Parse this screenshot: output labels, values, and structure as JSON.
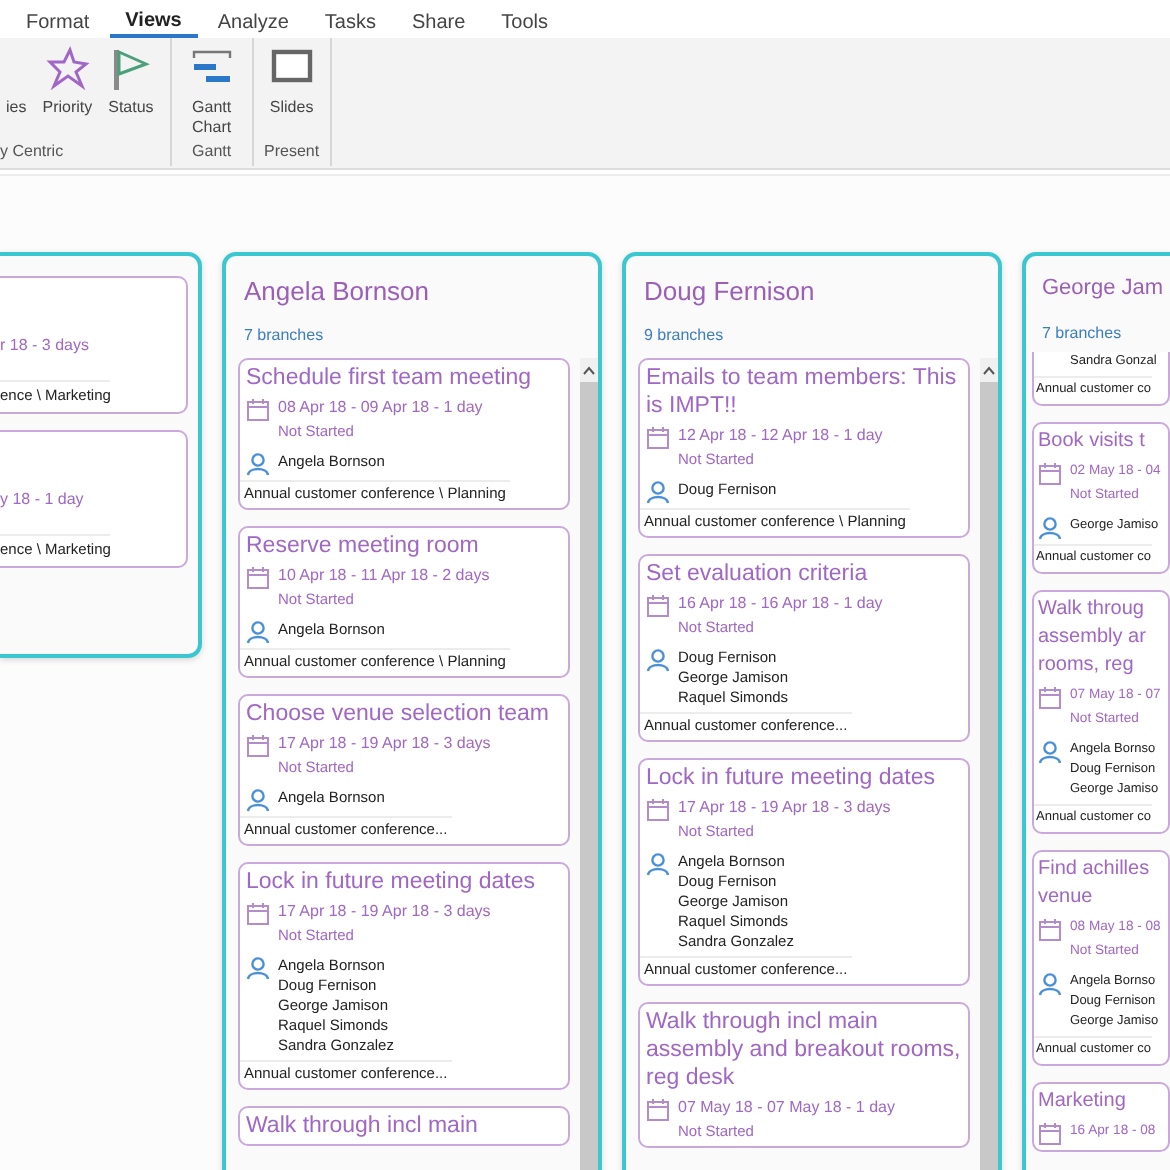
{
  "ribbon": {
    "tabs": [
      {
        "label": "Format",
        "selected": false
      },
      {
        "label": "Views",
        "selected": true
      },
      {
        "label": "Analyze",
        "selected": false
      },
      {
        "label": "Tasks",
        "selected": false
      },
      {
        "label": "Share",
        "selected": false
      },
      {
        "label": "Tools",
        "selected": false
      }
    ],
    "groups": [
      {
        "label": "y Centric",
        "kind": "cut",
        "buttons": [
          {
            "label": "ies"
          },
          {
            "label": "Priority"
          },
          {
            "label": "Status"
          }
        ]
      },
      {
        "label": "Gantt",
        "kind": "normal",
        "buttons": [
          {
            "label": "Gantt Chart"
          }
        ]
      },
      {
        "label": "Present",
        "kind": "normal",
        "buttons": [
          {
            "label": "Slides"
          }
        ]
      }
    ]
  },
  "columns": [
    {
      "kind": "left-cut",
      "cards": [
        {
          "kind": "left-cut",
          "date": "r 18 - 3 days",
          "project": "ence \\ Marketing"
        },
        {
          "kind": "left-cut",
          "date": "y 18 - 1 day",
          "project": "ence \\ Marketing"
        }
      ]
    },
    {
      "kind": "full",
      "name": "Angela Bornson",
      "branches": "7 branches",
      "cards": [
        {
          "kind": "full",
          "title": "Schedule first team meeting",
          "date": "08 Apr 18 - 09 Apr 18 - 1 day",
          "status": "Not Started",
          "people": [
            "Angela Bornson"
          ],
          "project": "Annual customer conference \\ Planning"
        },
        {
          "kind": "full",
          "title": "Reserve meeting room",
          "date": "10 Apr 18 - 11 Apr 18 - 2 days",
          "status": "Not Started",
          "people": [
            "Angela Bornson"
          ],
          "project": "Annual customer conference \\ Planning"
        },
        {
          "kind": "full",
          "title": "Choose venue selection team",
          "date": "17 Apr 18 - 19 Apr 18 - 3 days",
          "status": "Not Started",
          "people": [
            "Angela Bornson"
          ],
          "project": "Annual customer conference..."
        },
        {
          "kind": "full",
          "title": "Lock in future meeting dates",
          "date": "17 Apr 18 - 19 Apr 18 - 3 days",
          "status": "Not Started",
          "people": [
            "Angela Bornson",
            "Doug Fernison",
            "George Jamison",
            "Raquel Simonds",
            "Sandra Gonzalez"
          ],
          "project": "Annual customer conference..."
        },
        {
          "kind": "full",
          "title": "Walk through incl main"
        }
      ]
    },
    {
      "kind": "full",
      "name": "Doug Fernison",
      "branches": "9 branches",
      "cards": [
        {
          "kind": "full",
          "title": "Emails to team members: This is IMPT!!",
          "date": "12 Apr 18 - 12 Apr 18 - 1 day",
          "status": "Not Started",
          "people": [
            "Doug Fernison"
          ],
          "project": "Annual customer conference \\ Planning"
        },
        {
          "kind": "full",
          "title": "Set evaluation criteria",
          "date": "16 Apr 18 - 16 Apr 18 - 1 day",
          "status": "Not Started",
          "people": [
            "Doug Fernison",
            "George Jamison",
            "Raquel Simonds"
          ],
          "project": "Annual customer conference..."
        },
        {
          "kind": "full",
          "title": "Lock in future meeting dates",
          "date": "17 Apr 18 - 19 Apr 18 - 3 days",
          "status": "Not Started",
          "people": [
            "Angela Bornson",
            "Doug Fernison",
            "George Jamison",
            "Raquel Simonds",
            "Sandra Gonzalez"
          ],
          "project": "Annual customer conference..."
        },
        {
          "kind": "full",
          "title": "Walk through incl main assembly and breakout rooms, reg desk",
          "date": "07 May 18 - 07 May 18 - 1 day",
          "status": "Not Started"
        }
      ]
    },
    {
      "kind": "right-cut",
      "name": "George Jam",
      "branches": "7 branches",
      "cards": [
        {
          "kind": "top-cut",
          "people": [
            "Sandra Gonzal"
          ],
          "project": "Annual customer co"
        },
        {
          "kind": "full",
          "title": "Book visits t",
          "date": "02 May 18 - 04",
          "status": "Not Started",
          "people": [
            "George Jamiso"
          ],
          "project": "Annual customer co"
        },
        {
          "kind": "full",
          "title": "Walk throug\nassembly ar\nrooms, reg",
          "date": "07 May 18 - 07",
          "status": "Not Started",
          "people": [
            "Angela Bornso",
            "Doug Fernison",
            "George Jamiso"
          ],
          "project": "Annual customer co"
        },
        {
          "kind": "full",
          "title": "Find achilles\nvenue",
          "date": "08 May 18 - 08",
          "status": "Not Started",
          "people": [
            "Angela Bornso",
            "Doug Fernison",
            "George Jamiso"
          ],
          "project": "Annual customer co"
        },
        {
          "kind": "full",
          "title": "Marketing",
          "date": "16 Apr 18 - 08"
        }
      ]
    }
  ]
}
